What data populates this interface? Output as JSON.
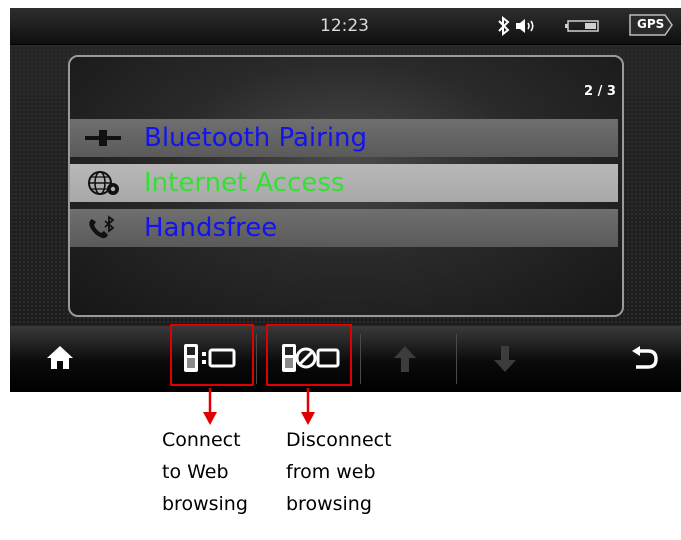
{
  "status_bar": {
    "time": "12:23",
    "bluetooth_icon": "bluetooth-icon",
    "volume_icon": "speaker-icon",
    "battery_icon": "battery-icon",
    "gps_label": "GPS"
  },
  "panel": {
    "page_indicator": "2 / 3",
    "menu_items": [
      {
        "label": "Bluetooth Pairing",
        "icon": "plug-icon",
        "selected": false
      },
      {
        "label": "Internet Access",
        "icon": "globe-gear-icon",
        "selected": true
      },
      {
        "label": "Handsfree",
        "icon": "phone-bluetooth-icon",
        "selected": false
      }
    ]
  },
  "toolbar": {
    "home": "home-icon",
    "connect": "connect-web-icon",
    "disconnect": "disconnect-web-icon",
    "up": "arrow-up-icon",
    "down": "arrow-down-icon",
    "back": "back-icon"
  },
  "callouts": {
    "connect": [
      "Connect",
      "to Web",
      "browsing"
    ],
    "disconnect": [
      "Disconnect",
      "from web",
      "browsing"
    ]
  },
  "colors": {
    "label_normal": "#1313f0",
    "label_selected": "#33e033",
    "callout_red": "#e00000"
  }
}
